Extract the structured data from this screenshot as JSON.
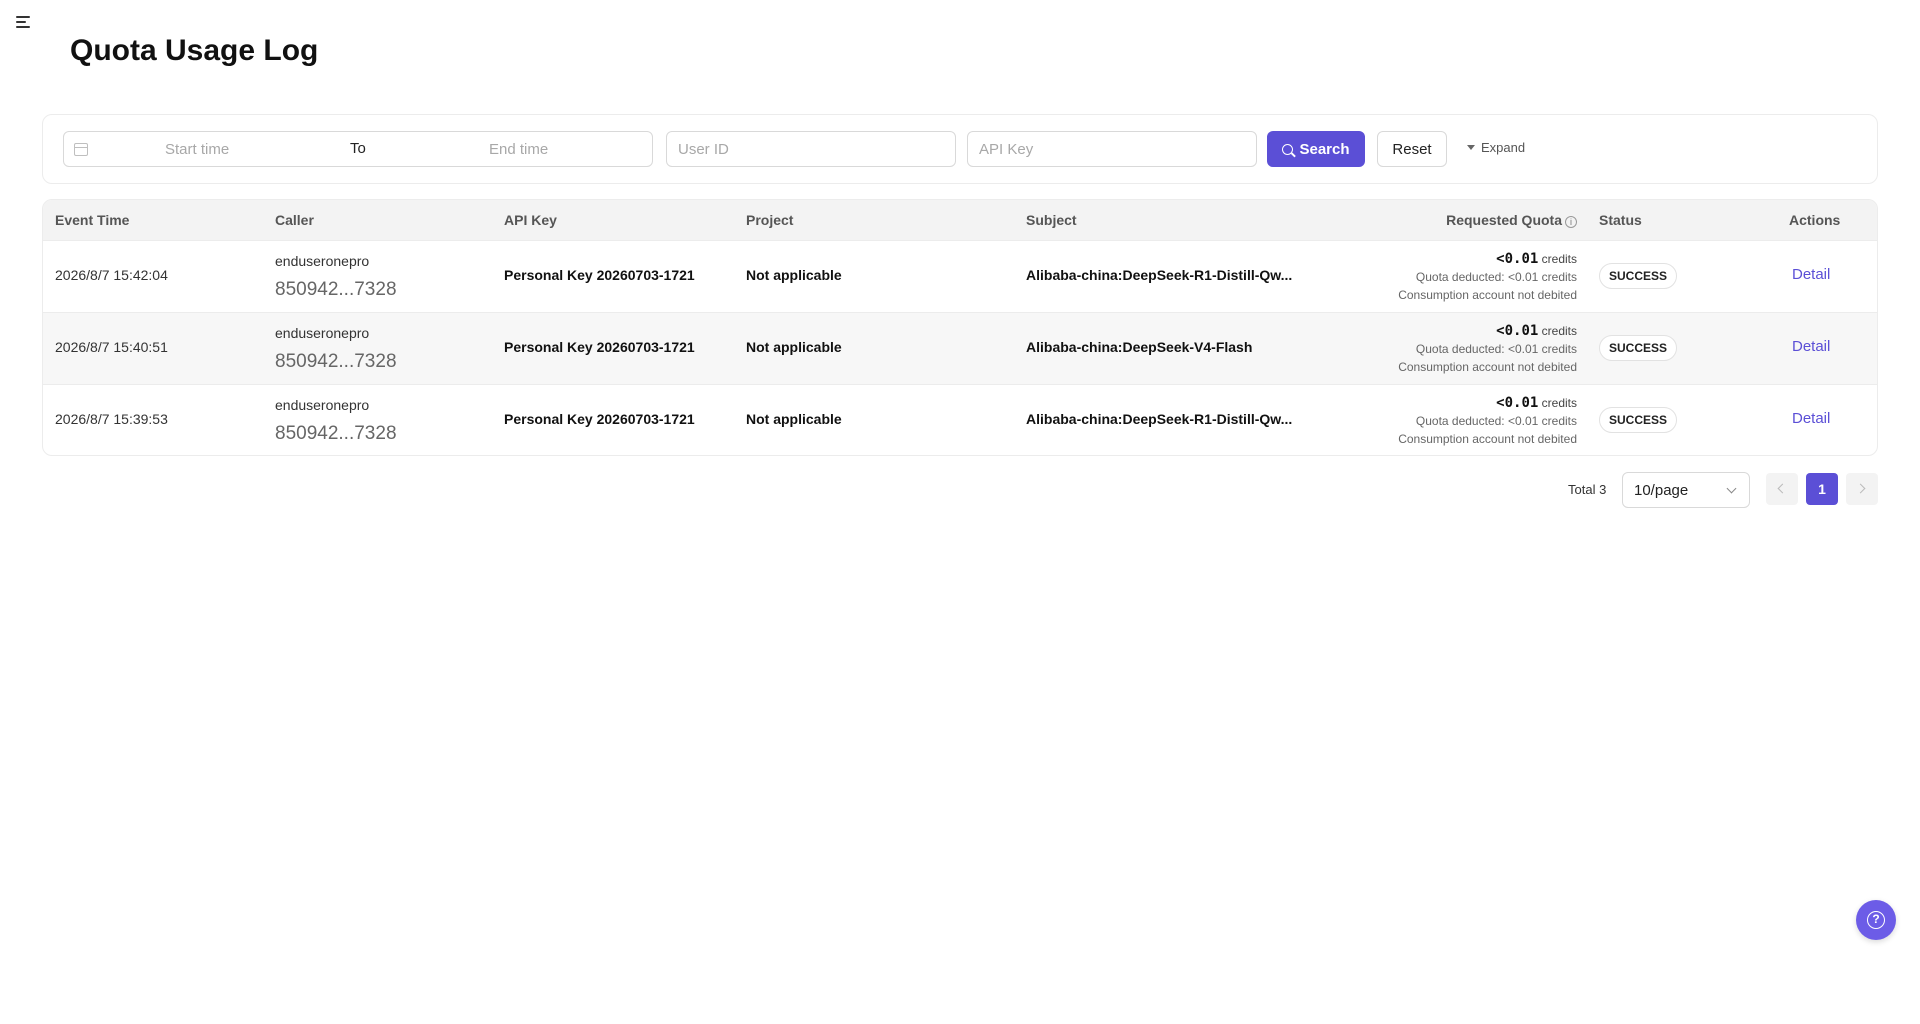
{
  "page": {
    "title": "Quota Usage Log"
  },
  "filters": {
    "start_placeholder": "Start time",
    "to_label": "To",
    "end_placeholder": "End time",
    "user_id_placeholder": "User ID",
    "api_key_placeholder": "API Key",
    "search_label": "Search",
    "reset_label": "Reset",
    "expand_label": "Expand"
  },
  "table": {
    "headers": {
      "event_time": "Event Time",
      "caller": "Caller",
      "api_key": "API Key",
      "project": "Project",
      "subject": "Subject",
      "requested_quota": "Requested Quota",
      "status": "Status",
      "actions": "Actions"
    },
    "rows": [
      {
        "event_time": "2026/8/7 15:42:04",
        "caller_name": "enduseronepro",
        "caller_id": "850942...7328",
        "api_key": "Personal Key 20260703-1721",
        "project": "Not applicable",
        "subject": "Alibaba-china:DeepSeek-R1-Distill-Qw...",
        "quota_value": "<0.01",
        "quota_unit": "credits",
        "quota_deducted": "Quota deducted: <0.01 credits",
        "quota_note": "Consumption account not debited",
        "status": "SUCCESS",
        "action": "Detail"
      },
      {
        "event_time": "2026/8/7 15:40:51",
        "caller_name": "enduseronepro",
        "caller_id": "850942...7328",
        "api_key": "Personal Key 20260703-1721",
        "project": "Not applicable",
        "subject": "Alibaba-china:DeepSeek-V4-Flash",
        "quota_value": "<0.01",
        "quota_unit": "credits",
        "quota_deducted": "Quota deducted: <0.01 credits",
        "quota_note": "Consumption account not debited",
        "status": "SUCCESS",
        "action": "Detail"
      },
      {
        "event_time": "2026/8/7 15:39:53",
        "caller_name": "enduseronepro",
        "caller_id": "850942...7328",
        "api_key": "Personal Key 20260703-1721",
        "project": "Not applicable",
        "subject": "Alibaba-china:DeepSeek-R1-Distill-Qw...",
        "quota_value": "<0.01",
        "quota_unit": "credits",
        "quota_deducted": "Quota deducted: <0.01 credits",
        "quota_note": "Consumption account not debited",
        "status": "SUCCESS",
        "action": "Detail"
      }
    ]
  },
  "pagination": {
    "total": "Total 3",
    "page_size": "10/page",
    "current_page": "1"
  },
  "icons": {
    "menu": "menu-icon",
    "calendar": "calendar-icon",
    "search": "search-icon",
    "expand": "caret-down-icon",
    "info": "info-icon",
    "help": "help-icon"
  },
  "colors": {
    "accent": "#5b4fd6",
    "help_button": "#6c5ce7"
  }
}
